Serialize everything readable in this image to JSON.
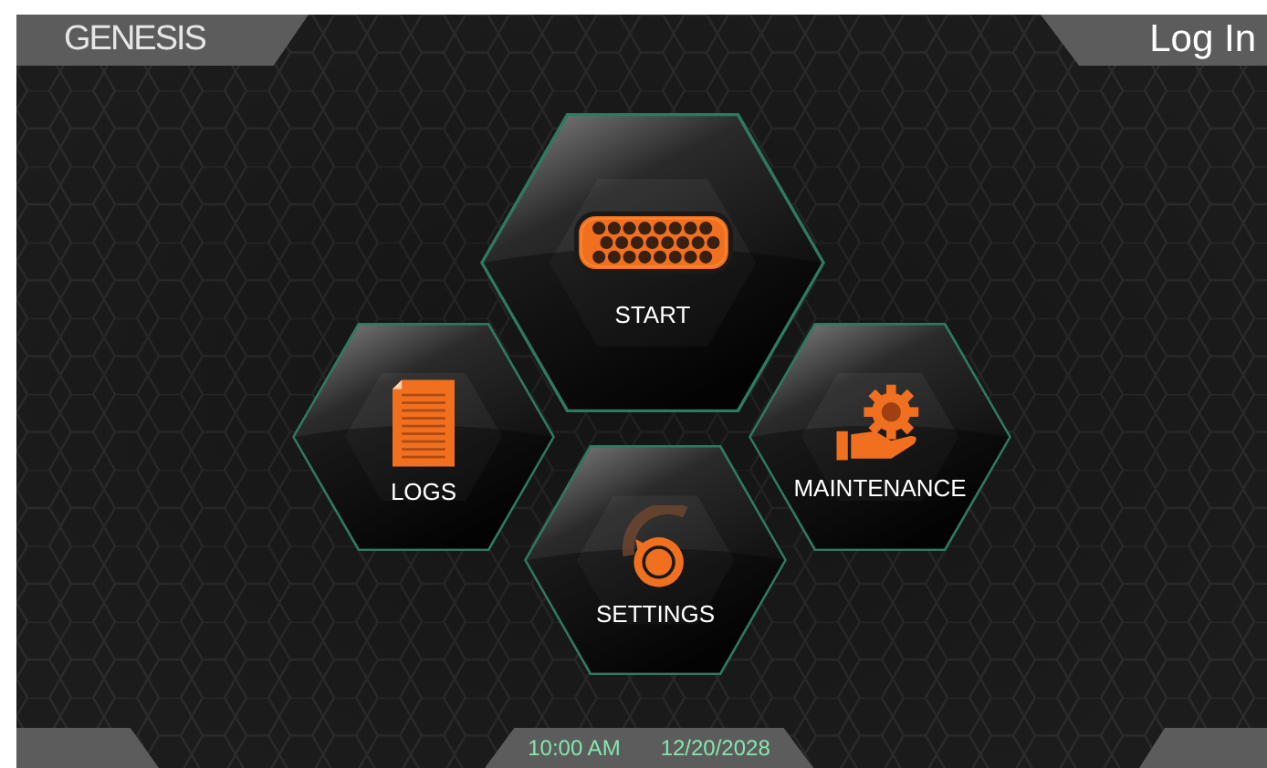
{
  "header": {
    "brand": "GENESIS",
    "login": "Log In"
  },
  "tiles": [
    {
      "label": "START",
      "kind": "start"
    },
    {
      "label": "LOGS",
      "kind": "logs"
    },
    {
      "label": "MAINTENANCE",
      "kind": "maintenance"
    },
    {
      "label": "SETTINGS",
      "kind": "settings"
    }
  ],
  "footer": {
    "time": "10:00 AM",
    "date": "12/20/2028"
  }
}
